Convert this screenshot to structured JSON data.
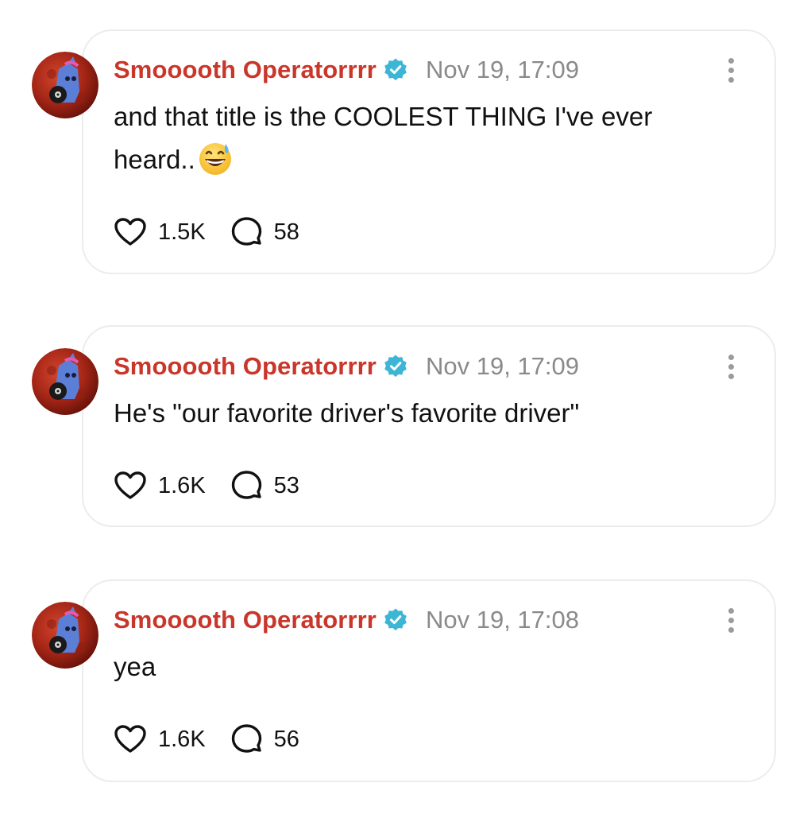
{
  "posts": [
    {
      "username": "Smooooth Operatorrrr",
      "timestamp": "Nov 19, 17:09",
      "text": "and that title is the COOLEST THING I've ever heard..",
      "likes": "1.5K",
      "comments": "58"
    },
    {
      "username": "Smooooth Operatorrrr",
      "timestamp": "Nov 19, 17:09",
      "text": "He's \"our favorite driver's favorite driver\"",
      "likes": "1.6K",
      "comments": "53"
    },
    {
      "username": "Smooooth Operatorrrr",
      "timestamp": "Nov 19, 17:08",
      "text": "yea",
      "likes": "1.6K",
      "comments": "56"
    }
  ],
  "icons": {
    "verified": "verified-badge-icon",
    "like": "heart-icon",
    "comment": "speech-bubble-icon",
    "more": "more-vertical-icon",
    "emoji": "grinning-face-with-sweat-emoji"
  },
  "colors": {
    "username": "#c9362a",
    "timestamp": "#8a8a8a",
    "badge": "#3db6d6",
    "card_border": "#ececec"
  }
}
